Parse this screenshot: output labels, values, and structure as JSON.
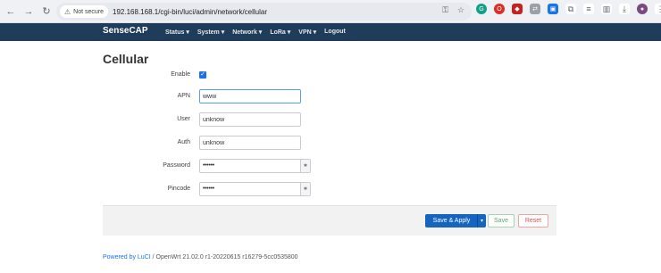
{
  "browser": {
    "not_secure_label": "Not secure",
    "url": "192.168.168.1/cgi-bin/luci/admin/network/cellular"
  },
  "header": {
    "brand": "SenseCAP",
    "menu": [
      "Status ▾",
      "System ▾",
      "Network ▾",
      "LoRa ▾",
      "VPN ▾",
      "Logout"
    ]
  },
  "page": {
    "title": "Cellular"
  },
  "form": {
    "enable_label": "Enable",
    "enable_checked": true,
    "apn_label": "APN",
    "apn_value": "www",
    "user_label": "User",
    "user_value": "unknow",
    "auth_label": "Auth",
    "auth_value": "unknow",
    "password_label": "Password",
    "password_value": "••••••",
    "pincode_label": "Pincode",
    "pincode_value": "••••••"
  },
  "actions": {
    "save_apply_label": "Save & Apply",
    "save_label": "Save",
    "reset_label": "Reset"
  },
  "footer": {
    "powered_by": "Powered by LuCI",
    "version": " / OpenWrt 21.02.0 r1-20220615 r16279-5cc0535800"
  },
  "colors": {
    "header_bg": "#1f3c5a",
    "primary": "#1565c0",
    "save": "#5aa96b",
    "reset": "#d9534f"
  }
}
